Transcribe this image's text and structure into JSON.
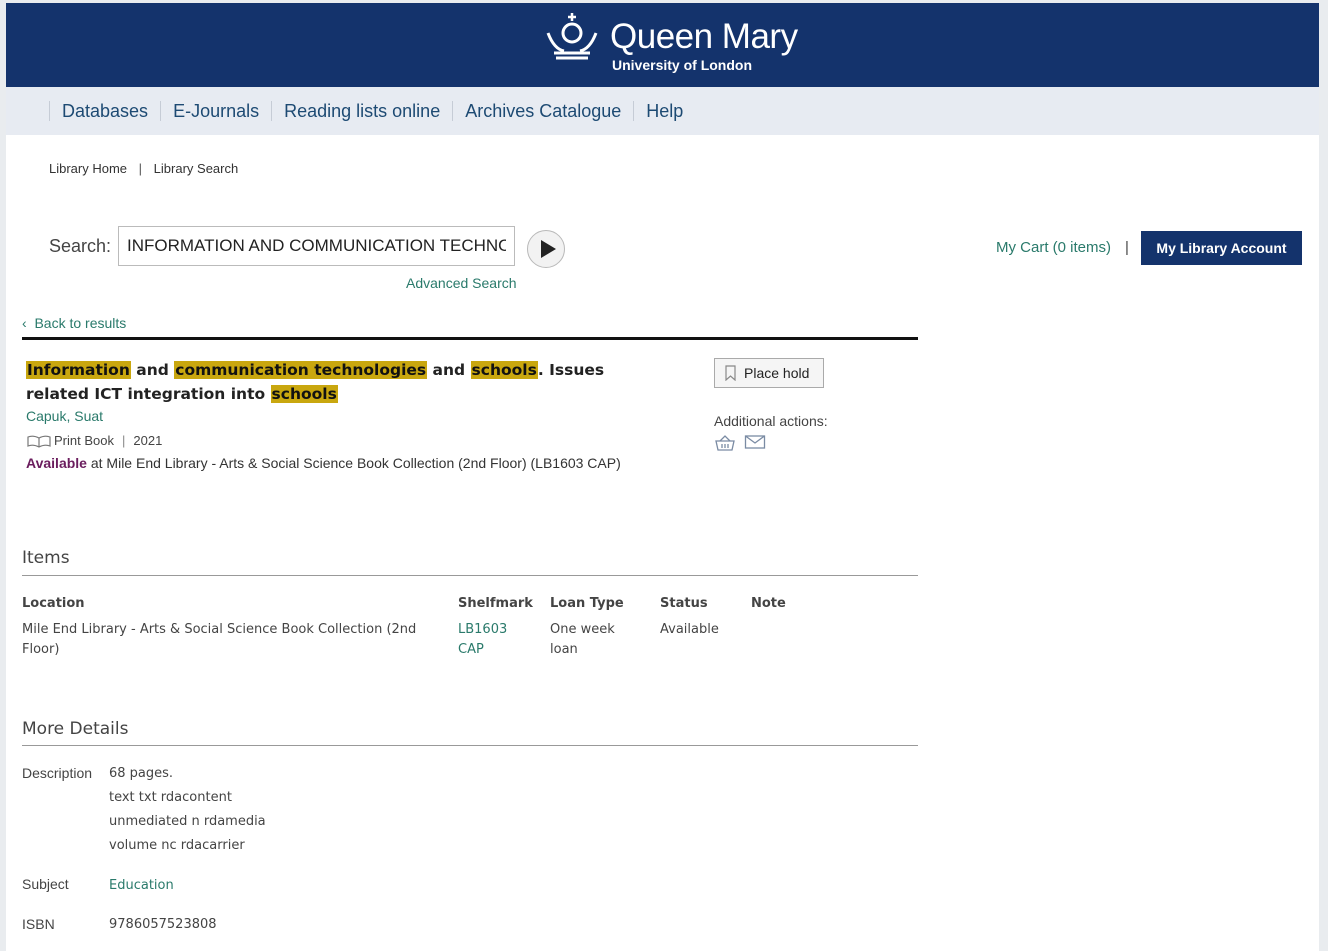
{
  "brand": {
    "name": "Queen Mary",
    "subtitle": "University of London"
  },
  "nav": {
    "items": [
      "Databases",
      "E-Journals",
      "Reading lists online",
      "Archives Catalogue",
      "Help"
    ]
  },
  "breadcrumb": {
    "home": "Library Home",
    "separator": "|",
    "current": "Library Search"
  },
  "search": {
    "label": "Search:",
    "value": "INFORMATION AND COMMUNICATION TECHNOLOGIES AND SCHOOLS",
    "advanced": "Advanced Search"
  },
  "account": {
    "cart": "My Cart (0 items)",
    "separator": "|",
    "my_account": "My Library Account"
  },
  "back": {
    "label": "Back to results"
  },
  "record": {
    "title_parts": [
      {
        "text": "Information",
        "highlight": true
      },
      {
        "text": " and ",
        "highlight": false
      },
      {
        "text": "communication technologies",
        "highlight": true
      },
      {
        "text": " and ",
        "highlight": false
      },
      {
        "text": "schools",
        "highlight": true
      },
      {
        "text": ". Issues related ICT integration into ",
        "highlight": false
      },
      {
        "text": "schools",
        "highlight": true
      }
    ],
    "author": "Capuk, Suat",
    "format": "Print Book",
    "year": "2021",
    "status": "Available",
    "location_text": " at Mile End Library - Arts & Social Science Book Collection (2nd Floor) (LB1603 CAP)"
  },
  "actions": {
    "place_hold": "Place hold",
    "additional": "Additional actions:"
  },
  "items": {
    "heading": "Items",
    "columns": [
      "Location",
      "Shelfmark",
      "Loan Type",
      "Status",
      "Note"
    ],
    "rows": [
      {
        "location": "Mile End Library - Arts & Social Science Book Collection (2nd Floor)",
        "shelfmark": "LB1603 CAP",
        "loan_type": "One week loan",
        "status": "Available",
        "note": ""
      }
    ]
  },
  "details": {
    "heading": "More Details",
    "description_label": "Description",
    "description": [
      "68 pages.",
      "text txt rdacontent",
      "unmediated n rdamedia",
      "volume nc rdacarrier"
    ],
    "subject_label": "Subject",
    "subject": "Education",
    "isbn_label": "ISBN",
    "isbn": "9786057523808"
  },
  "colors": {
    "header_bg": "#14336c",
    "navbar_bg": "#e7ebf2",
    "link": "#2a7a6b",
    "highlight": "#c9a70f",
    "available": "#6b1d5e"
  }
}
